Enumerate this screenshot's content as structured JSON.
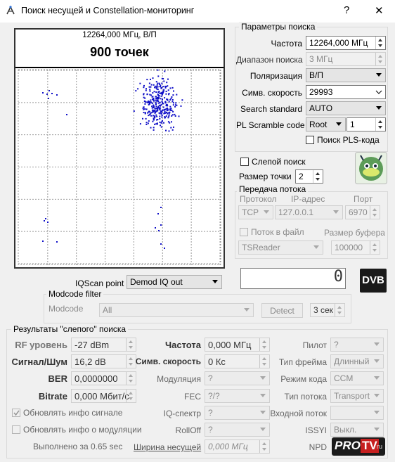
{
  "window": {
    "title": "Поиск несущей и Constellation-мониторинг",
    "help": "?",
    "close": "✕"
  },
  "constellation": {
    "header": "12264,000 МГц, В/П",
    "points_label": "900 точек"
  },
  "search_params": {
    "group": "Параметры поиска",
    "freq_label": "Частота",
    "freq_value": "12264,000 МГц",
    "range_label": "Диапазон поиска",
    "range_value": "3 МГц",
    "pol_label": "Поляризация",
    "pol_value": "В/П",
    "sr_label": "Симв. скорость",
    "sr_value": "29993",
    "std_label": "Search standard",
    "std_value": "AUTO",
    "pls_label": "PL Scramble code",
    "pls_mode": "Root",
    "pls_value": "1",
    "pls_search_label": "Поиск PLS-кода"
  },
  "blind": {
    "label": "Слепой поиск",
    "dot_size_label": "Размер точки",
    "dot_size_value": "2"
  },
  "stream": {
    "group": "Передача потока",
    "proto_label": "Протокол",
    "ip_label": "IP-адрес",
    "port_label": "Порт",
    "proto_value": "TCP",
    "ip_value": "127.0.0.1",
    "port_value": "6970",
    "file_label": "Поток в файл",
    "buf_label": "Размер буфера",
    "reader_value": "TSReader",
    "buf_value": "100000"
  },
  "display_value": "0",
  "dvb_logo": "DVB",
  "iqscan": {
    "label": "IQScan point",
    "value": "Demod IQ out"
  },
  "modcode": {
    "group": "Modcode filter",
    "label": "Modcode",
    "value": "All",
    "detect": "Detect",
    "timeout": "3 сек"
  },
  "results": {
    "group": "Результаты \"слепого\" поиска",
    "rf_label": "RF уровень",
    "rf_value": "-27 dBm",
    "snr_label": "Сигнал/Шум",
    "snr_value": "16,2 dB",
    "ber_label": "BER",
    "ber_value": "0,0000000",
    "bitrate_label": "Bitrate",
    "bitrate_value": "0,000 Мбит/с",
    "freq_label": "Частота",
    "freq_value": "0,000 МГц",
    "sr_label": "Симв. скорость",
    "sr_value": "0 Кс",
    "mod_label": "Модуляция",
    "mod_value": "?",
    "fec_label": "FEC",
    "fec_value": "?/?",
    "iq_label": "IQ-спектр",
    "iq_value": "?",
    "rolloff_label": "RollOff",
    "rolloff_value": "?",
    "bw_label": "Ширина несущей",
    "bw_value": "0,000 МГц",
    "pilot_label": "Пилот",
    "pilot_value": "?",
    "frame_label": "Тип фрейма",
    "frame_value": "Длинный",
    "code_label": "Режим кода",
    "code_value": "CCM",
    "stype_label": "Тип потока",
    "stype_value": "Transport",
    "input_label": "Входной поток",
    "input_value": "",
    "issyi_label": "ISSYI",
    "issyi_value": "Выкл.",
    "npd_label": "NPD",
    "upd_signal": "Обновлять инфо сигнале",
    "upd_mod": "Обновлять инфо о модуляции",
    "done": "Выполнено за 0.65 sec"
  },
  "watermark": {
    "pro": "PRO",
    "tv": "TV",
    "ru": "ru"
  }
}
